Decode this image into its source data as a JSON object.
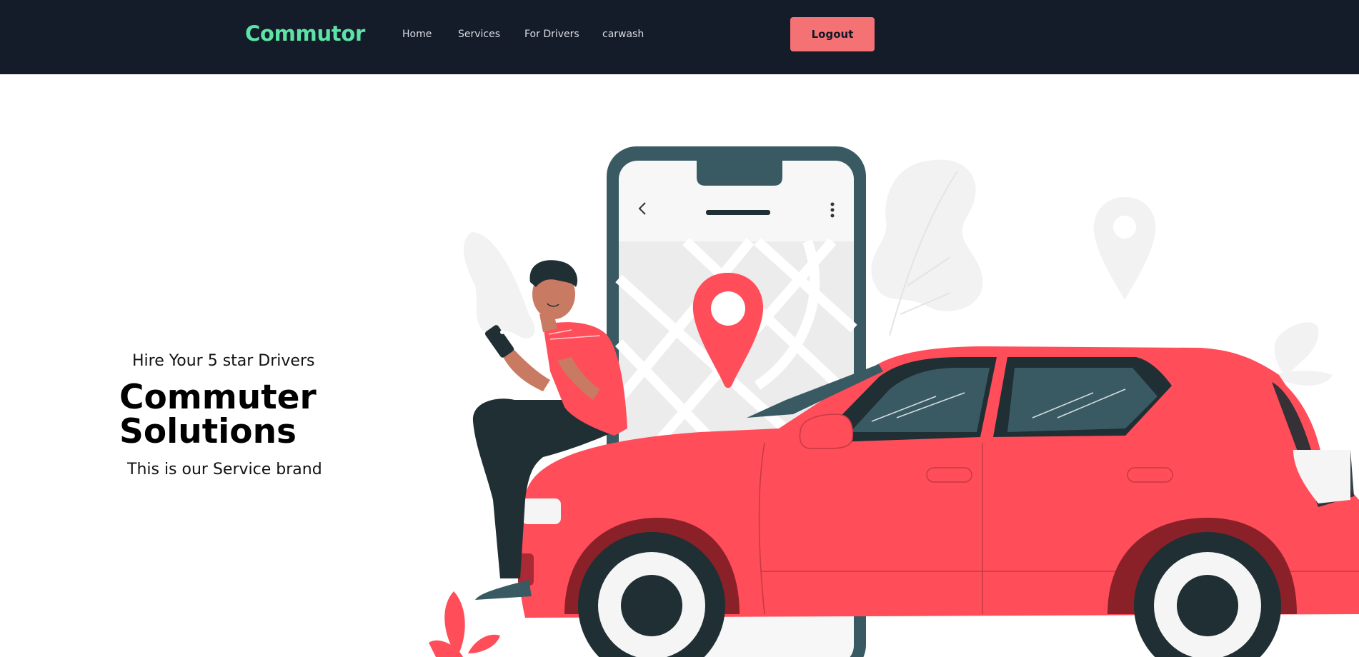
{
  "navbar": {
    "brand": "Commutor",
    "links": [
      {
        "label": "Home"
      },
      {
        "label": "Services"
      },
      {
        "label": "For Drivers"
      },
      {
        "label": "carwash"
      }
    ],
    "logout_label": "Logout",
    "background": "#141b29",
    "brand_color": "#5ee3a6",
    "button_color": "#f47174"
  },
  "hero": {
    "tagline": "Hire Your 5 star Drivers",
    "headline_line1": "Commuter",
    "headline_line2": "Solutions",
    "subline": "This is our Service brand",
    "illustration": {
      "icons": [
        "phone-map-icon",
        "location-pin-icon",
        "person-icon",
        "car-icon",
        "leaf-icon"
      ],
      "accent_color": "#ff4d5a",
      "dark_color": "#1f2f33"
    }
  }
}
